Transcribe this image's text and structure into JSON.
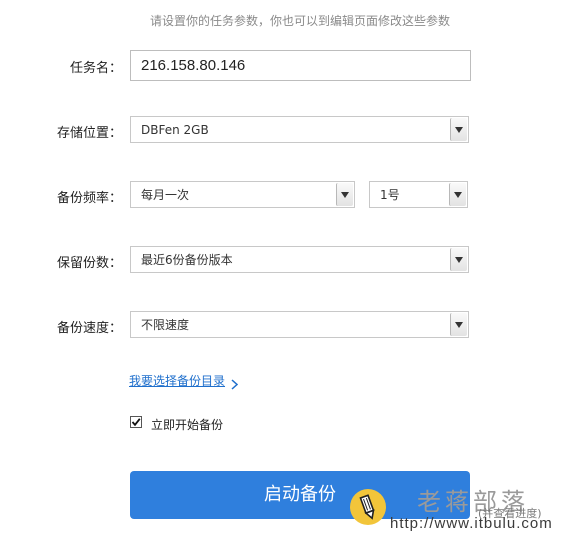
{
  "hint": "请设置你的任务参数，你也可以到编辑页面修改这些参数",
  "form": {
    "task_name": {
      "label": "任务名：",
      "value": "216.158.80.146"
    },
    "storage": {
      "label": "存储位置：",
      "value": "DBFen 2GB"
    },
    "frequency": {
      "label": "备份频率：",
      "period": "每月一次",
      "day": "1号"
    },
    "retention": {
      "label": "保留份数：",
      "value": "最近6份备份版本"
    },
    "speed": {
      "label": "备份速度：",
      "value": "不限速度"
    }
  },
  "choose_dir_link": "我要选择备份目录",
  "start_now": {
    "label": "立即开始备份",
    "checked": true
  },
  "start_button": "启动备份",
  "watermark": {
    "title": "老蒋部落",
    "url": "http://www.itbulu.com",
    "note": "(并查看进度)"
  },
  "colors": {
    "primary": "#2f7fdd",
    "link": "#1f6fcc",
    "badge": "#f2c53a"
  },
  "icons": [
    "dropdown-arrow-icon",
    "chevron-right-icon",
    "checkmark-icon",
    "pencil-badge-icon"
  ]
}
